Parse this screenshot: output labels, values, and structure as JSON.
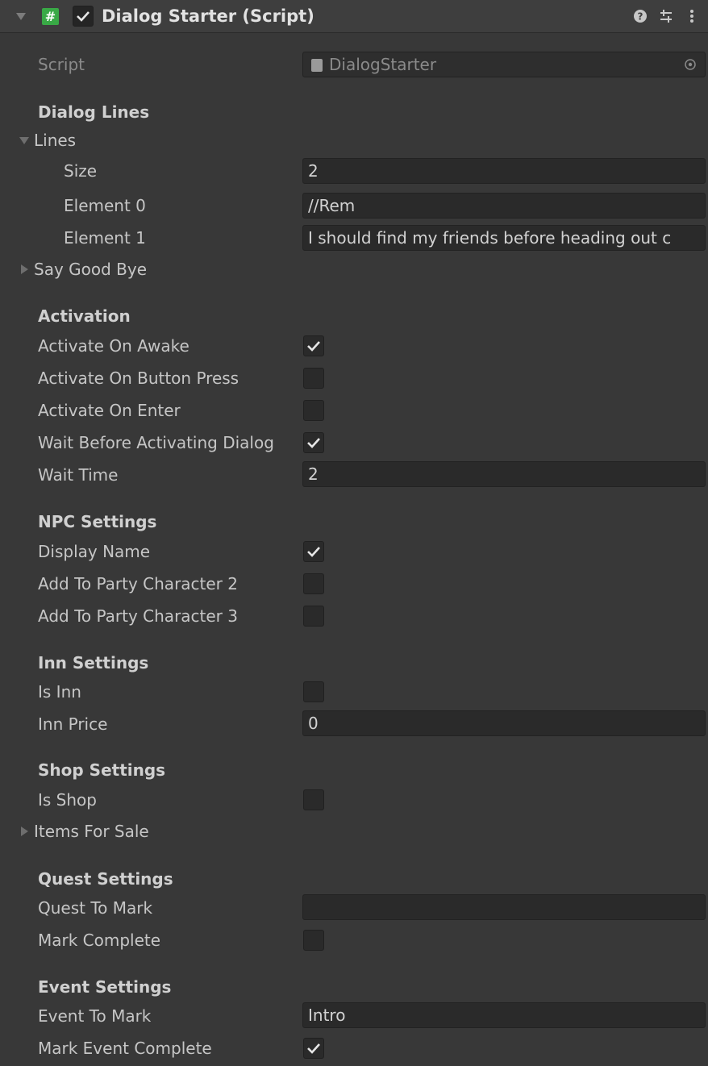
{
  "header": {
    "title": "Dialog Starter (Script)",
    "script_icon_glyph": "#",
    "enabled": true,
    "icons": [
      "help-icon",
      "presets-icon",
      "more-menu-icon"
    ]
  },
  "script_field": {
    "label": "Script",
    "value": "DialogStarter"
  },
  "dialog_lines": {
    "heading": "Dialog Lines",
    "lines_label": "Lines",
    "size_label": "Size",
    "size_value": "2",
    "elements": [
      {
        "label": "Element 0",
        "value": "//Rem"
      },
      {
        "label": "Element 1",
        "value": "I should find my friends before heading out c"
      }
    ],
    "say_good_bye_label": "Say Good Bye"
  },
  "activation": {
    "heading": "Activation",
    "activate_on_awake": {
      "label": "Activate On Awake",
      "checked": true
    },
    "activate_on_button_press": {
      "label": "Activate On Button Press",
      "checked": false
    },
    "activate_on_enter": {
      "label": "Activate On Enter",
      "checked": false
    },
    "wait_before_activating": {
      "label": "Wait Before Activating Dialog",
      "checked": true
    },
    "wait_time": {
      "label": "Wait Time",
      "value": "2"
    }
  },
  "npc_settings": {
    "heading": "NPC Settings",
    "display_name": {
      "label": "Display Name",
      "checked": true
    },
    "add_party_2": {
      "label": "Add To Party Character 2",
      "checked": false
    },
    "add_party_3": {
      "label": "Add To Party Character 3",
      "checked": false
    }
  },
  "inn_settings": {
    "heading": "Inn Settings",
    "is_inn": {
      "label": "Is Inn",
      "checked": false
    },
    "inn_price": {
      "label": "Inn Price",
      "value": "0"
    }
  },
  "shop_settings": {
    "heading": "Shop Settings",
    "is_shop": {
      "label": "Is Shop",
      "checked": false
    },
    "items_for_sale_label": "Items For Sale"
  },
  "quest_settings": {
    "heading": "Quest Settings",
    "quest_to_mark": {
      "label": "Quest To Mark",
      "value": ""
    },
    "mark_complete": {
      "label": "Mark Complete",
      "checked": false
    }
  },
  "event_settings": {
    "heading": "Event Settings",
    "event_to_mark": {
      "label": "Event To Mark",
      "value": "Intro"
    },
    "mark_event_complete": {
      "label": "Mark Event Complete",
      "checked": true
    }
  },
  "colors": {
    "panel_bg": "#383838",
    "header_bg": "#3e3e3e",
    "field_bg": "#2a2a2a",
    "script_icon_green": "#39a946",
    "text": "#c6c6c6"
  }
}
